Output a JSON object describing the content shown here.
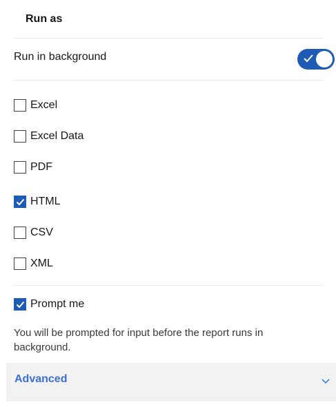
{
  "section": {
    "title": "Run as"
  },
  "background": {
    "label": "Run in background",
    "enabled": true
  },
  "formats": [
    {
      "label": "Excel",
      "checked": false
    },
    {
      "label": "Excel Data",
      "checked": false
    },
    {
      "label": "PDF",
      "checked": false
    },
    {
      "label": "HTML",
      "checked": true
    },
    {
      "label": "CSV",
      "checked": false
    },
    {
      "label": "XML",
      "checked": false
    }
  ],
  "prompt": {
    "label": "Prompt me",
    "checked": true,
    "note": "You will be prompted for input before the report runs in background."
  },
  "advanced": {
    "label": "Advanced",
    "icon": "chevron-down-icon"
  },
  "colors": {
    "accent": "#1e5bb4",
    "link": "#3b6fd6",
    "advanced_bg": "#f2f2f2"
  }
}
